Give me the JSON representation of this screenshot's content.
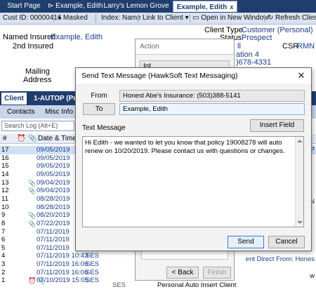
{
  "tabs": [
    {
      "label": "Start Page"
    },
    {
      "label": "Example, Edith"
    },
    {
      "label": "Larry's Lemon Grove"
    },
    {
      "label": "Example, Edith"
    }
  ],
  "tab_close": "x",
  "toolbar": {
    "cust_id": "Cust ID: 00000416",
    "masked": "Masked",
    "index": "Index: Name",
    "link": "Link to Client",
    "open_new": "Open in New Window",
    "refresh": "Refresh Client"
  },
  "info": {
    "named_insured_label": "Named Insured",
    "named_insured_value": "Example, Edith",
    "second_insured_label": "2nd Insured",
    "client_type_label": "Client Type",
    "client_type_value": "Customer (Personal)",
    "status_label": "Status",
    "status_value": "Prospect",
    "mailing_label": "Mailing",
    "address_label": "Address",
    "frag_ll": "ll",
    "csr_label": "CSR",
    "csr_value": "RMN",
    "location_frag": "ation 4",
    "phone_frag": ")678-4331"
  },
  "client_tabs": {
    "client": "Client",
    "policy": "1-AUTOP (Pros"
  },
  "sub_tabs": {
    "contacts": "Contacts",
    "misc": "Misc Info"
  },
  "search_placeholder": "Search Log (Alt+E)",
  "log_header": {
    "hash": "#",
    "date_time": "Date & Time"
  },
  "log_rows": [
    {
      "num": "17",
      "clip": "",
      "dt": "09/05/2019",
      "who": "",
      "sel": true
    },
    {
      "num": "16",
      "clip": "",
      "dt": "09/05/2019",
      "who": ""
    },
    {
      "num": "15",
      "clip": "",
      "dt": "09/05/2019",
      "who": ""
    },
    {
      "num": "14",
      "clip": "",
      "dt": "09/05/2019",
      "who": ""
    },
    {
      "num": "13",
      "clip": "📎",
      "dt": "09/04/2019",
      "who": ""
    },
    {
      "num": "12",
      "clip": "📎",
      "dt": "09/04/2019",
      "who": ""
    },
    {
      "num": "11",
      "clip": "",
      "dt": "08/28/2019",
      "who": ""
    },
    {
      "num": "10",
      "clip": "",
      "dt": "08/28/2019",
      "who": ""
    },
    {
      "num": "9",
      "clip": "📎",
      "dt": "08/20/2019",
      "who": ""
    },
    {
      "num": "8",
      "clip": "📎",
      "dt": "07/22/2019",
      "who": ""
    },
    {
      "num": "7",
      "clip": "",
      "dt": "07/11/2019",
      "who": ""
    },
    {
      "num": "6",
      "clip": "",
      "dt": "07/11/2019",
      "who": ""
    },
    {
      "num": "5",
      "clip": "",
      "dt": "07/11/2019",
      "who": ""
    },
    {
      "num": "4",
      "clip": "",
      "dt": "07/11/2019 10:43",
      "who": "SES"
    },
    {
      "num": "3",
      "clip": "",
      "dt": "07/11/2019 16:06",
      "who": "SES"
    },
    {
      "num": "2",
      "clip": "",
      "dt": "07/11/2019 16:06",
      "who": "SES"
    },
    {
      "num": "1",
      "clip": "⏰ 📎",
      "dt": "07/10/2019 15:05",
      "who": "SES"
    }
  ],
  "row1_extra": "SES",
  "row1_desc": "Personal Auto Insert Client",
  "right_frags": {
    "p": "P",
    "n": "N",
    "ent_direct": "ent Direct From: Hones",
    "w_frag": "w"
  },
  "action": {
    "title": "Action",
    "field": "Int",
    "back": "< Back",
    "finish": "Finish"
  },
  "dialog": {
    "title": "Send Text Message (HawkSoft Text Messaging)",
    "close": "✕",
    "from_label": "From",
    "from_value": "Honest Abe's Insurance: (503)388-5141",
    "to_label": "To",
    "to_value": "Example, Edith",
    "text_label": "Text Message",
    "insert_field": "Insert Field",
    "message": "Hi Edith - we wanted to let you know that policy 19008278  will auto renew on 10/20/2019. Please contact us with questions or changes.",
    "send": "Send",
    "cancel": "Cancel"
  }
}
